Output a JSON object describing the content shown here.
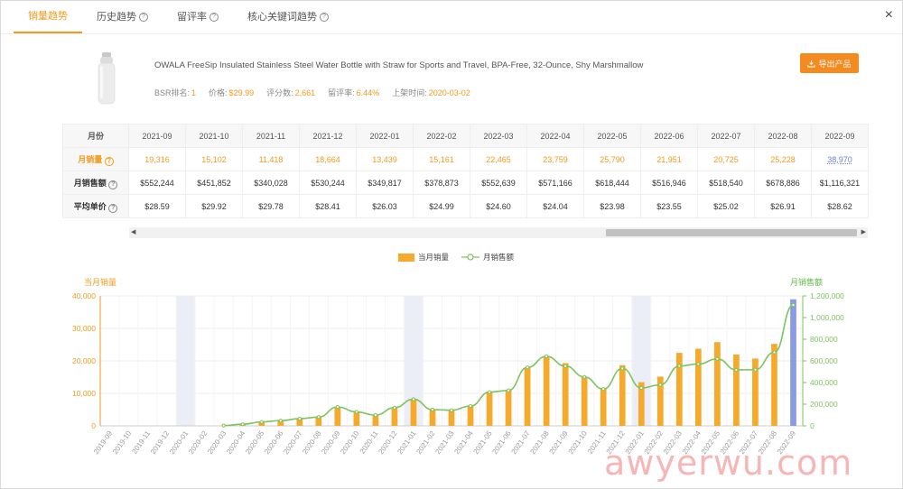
{
  "tabs": [
    {
      "label": "销量趋势",
      "active": true,
      "help": false
    },
    {
      "label": "历史趋势",
      "active": false,
      "help": true
    },
    {
      "label": "留评率",
      "active": false,
      "help": true
    },
    {
      "label": "核心关键词趋势",
      "active": false,
      "help": true
    }
  ],
  "close_label": "×",
  "product": {
    "title": "OWALA FreeSip Insulated Stainless Steel Water Bottle with Straw for Sports and Travel, BPA-Free, 32-Ounce, Shy Marshmallow",
    "meta": [
      {
        "label": "BSR排名:",
        "value": "1"
      },
      {
        "label": "价格:",
        "value": "$29.99"
      },
      {
        "label": "评分数:",
        "value": "2,661"
      },
      {
        "label": "留评率:",
        "value": "6.44%"
      },
      {
        "label": "上架时间:",
        "value": "2020-03-02"
      }
    ],
    "export_label": "导出产品"
  },
  "table": {
    "header_label": "月份",
    "months": [
      "2021-09",
      "2021-10",
      "2021-11",
      "2021-12",
      "2022-01",
      "2022-02",
      "2022-03",
      "2022-04",
      "2022-05",
      "2022-06",
      "2022-07",
      "2022-08",
      "2022-09"
    ],
    "rows": [
      {
        "label": "月销量",
        "help": true,
        "values": [
          "19,316",
          "15,102",
          "11,418",
          "18,664",
          "13,439",
          "15,161",
          "22,465",
          "23,759",
          "25,790",
          "21,951",
          "20,725",
          "25,228",
          "38,970"
        ]
      },
      {
        "label": "月销售额",
        "help": true,
        "values": [
          "$552,244",
          "$451,852",
          "$340,028",
          "$530,244",
          "$349,817",
          "$378,873",
          "$552,639",
          "$571,166",
          "$618,444",
          "$516,946",
          "$518,540",
          "$678,886",
          "$1,116,321"
        ]
      },
      {
        "label": "平均单价",
        "help": true,
        "values": [
          "$28.59",
          "$29.92",
          "$29.78",
          "$28.41",
          "$26.03",
          "$24.99",
          "$24.60",
          "$24.04",
          "$23.98",
          "$23.55",
          "$25.02",
          "$26.91",
          "$28.62"
        ]
      }
    ]
  },
  "chart_data": {
    "type": "bar",
    "legend": [
      "当月销量",
      "月销售额"
    ],
    "ylabel_left": "当月销量",
    "ylabel_right": "月销售额",
    "ylim_left": [
      0,
      40000
    ],
    "ylim_right": [
      0,
      1200000
    ],
    "yticks_left": [
      "0",
      "10,000",
      "20,000",
      "30,000",
      "40,000"
    ],
    "yticks_right": [
      "0",
      "200,000",
      "400,000",
      "600,000",
      "800,000",
      "1,000,000",
      "1,200,000"
    ],
    "categories": [
      "2019-09",
      "2019-10",
      "2019-11",
      "2019-12",
      "2020-01",
      "2020-02",
      "2020-03",
      "2020-04",
      "2020-05",
      "2020-06",
      "2020-07",
      "2020-08",
      "2020-09",
      "2020-10",
      "2020-11",
      "2020-12",
      "2021-01",
      "2021-02",
      "2021-03",
      "2021-04",
      "2021-05",
      "2021-06",
      "2021-07",
      "2021-08",
      "2021-09",
      "2021-10",
      "2021-11",
      "2021-12",
      "2022-01",
      "2022-02",
      "2022-03",
      "2022-04",
      "2022-05",
      "2022-06",
      "2022-07",
      "2022-08",
      "2022-09"
    ],
    "series": [
      {
        "name": "当月销量",
        "type": "bar",
        "values": [
          0,
          0,
          0,
          0,
          0,
          0,
          100,
          500,
          1200,
          1600,
          2200,
          2700,
          5800,
          4300,
          3300,
          5600,
          8200,
          5000,
          4800,
          6100,
          10400,
          10900,
          18000,
          21400,
          19316,
          15102,
          11418,
          18664,
          13439,
          15161,
          22465,
          23759,
          25790,
          21951,
          20725,
          25228,
          38970
        ]
      },
      {
        "name": "月销售额",
        "type": "line",
        "values": [
          null,
          null,
          null,
          null,
          null,
          null,
          3000,
          15000,
          36000,
          48000,
          66000,
          81000,
          174000,
          129000,
          99000,
          168000,
          246000,
          150000,
          144000,
          183000,
          312000,
          327000,
          540000,
          642000,
          552244,
          451852,
          340028,
          530244,
          349817,
          378873,
          552639,
          571166,
          618444,
          516946,
          518540,
          678886,
          1116321
        ]
      }
    ],
    "highlight_bar": "2022-09",
    "grid": true
  },
  "colors": {
    "accent": "#f39a1c",
    "bar": "#f5aa2c",
    "bar_highlight": "#8a9be3",
    "line": "#7dc35f",
    "shade": "#eceef7"
  },
  "watermark": "awyerwu.com"
}
